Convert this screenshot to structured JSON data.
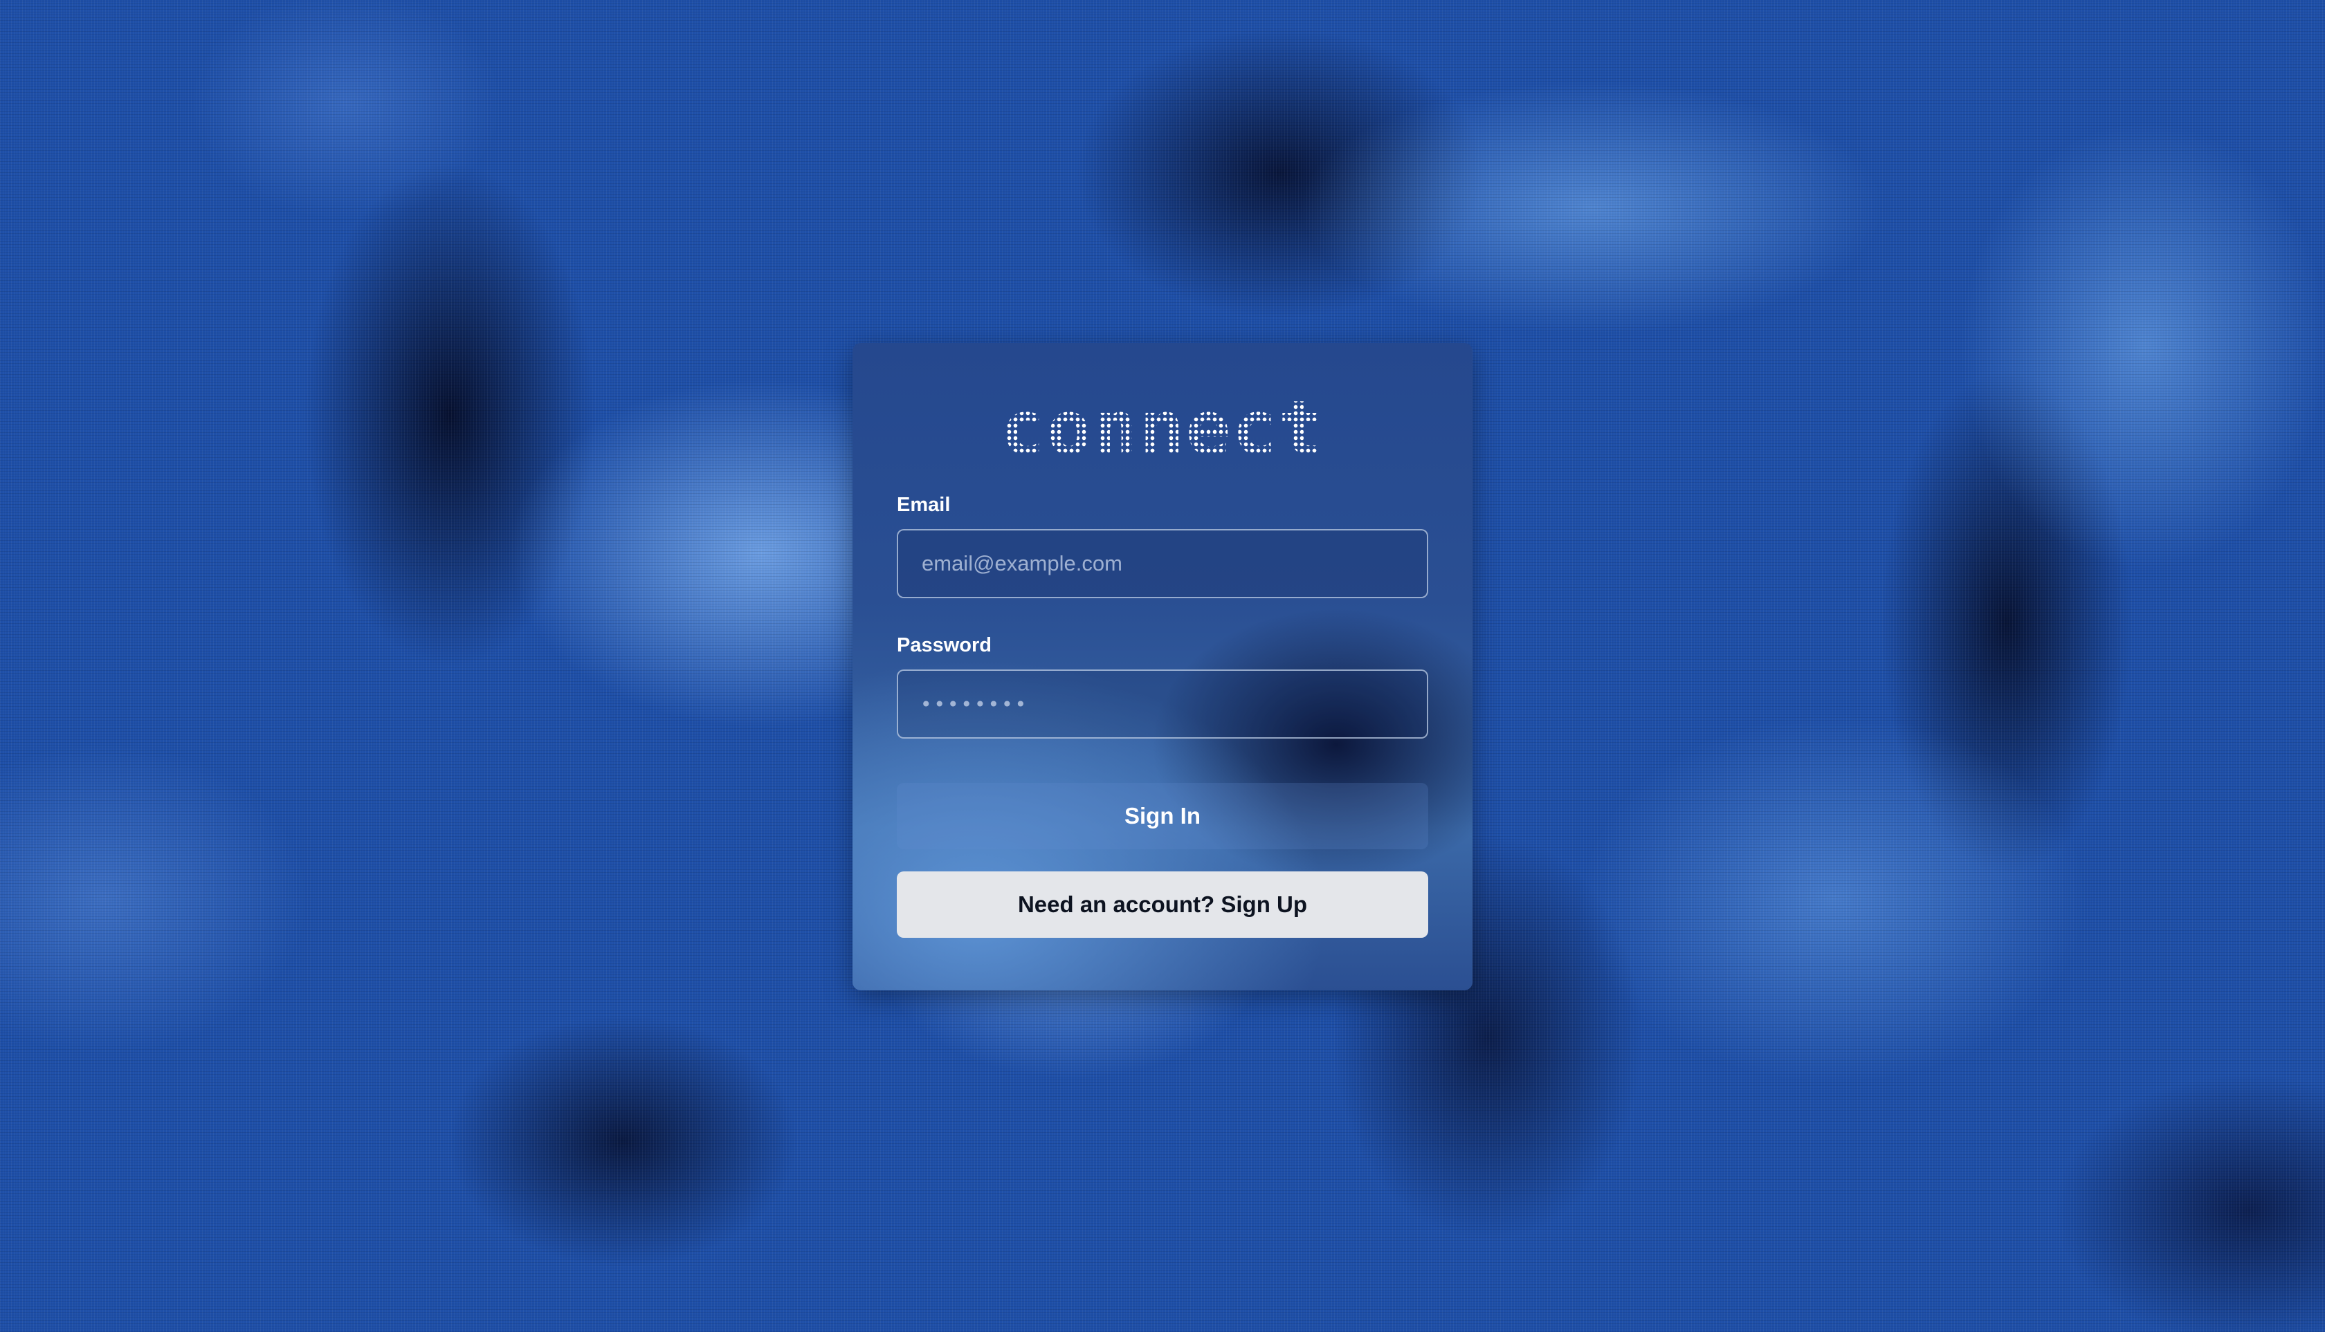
{
  "app": {
    "logo_text": "connect"
  },
  "form": {
    "email": {
      "label": "Email",
      "placeholder": "email@example.com",
      "value": ""
    },
    "password": {
      "label": "Password",
      "placeholder": "••••••••",
      "value": ""
    },
    "sign_in_label": "Sign In",
    "sign_up_label": "Need an account? Sign Up"
  },
  "colors": {
    "background": "#1e4fa8",
    "card": "#2a4f93",
    "secondary_button": "#e4e6ea",
    "secondary_button_text": "#0d1320"
  }
}
